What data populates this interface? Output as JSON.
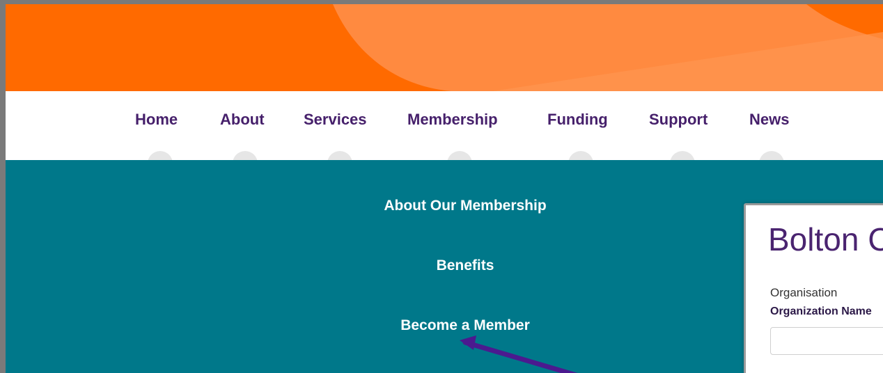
{
  "colors": {
    "hero_orange": "#ff6a00",
    "hero_shape": "#ff8a40",
    "nav_text": "#46206b",
    "dropdown_teal": "#00788a",
    "annotation_arrow": "#4b1a8f"
  },
  "nav": {
    "items": [
      {
        "label": "Home"
      },
      {
        "label": "About"
      },
      {
        "label": "Services"
      },
      {
        "label": "Membership"
      },
      {
        "label": "Funding"
      },
      {
        "label": "Support"
      },
      {
        "label": "News"
      }
    ]
  },
  "dropdown": {
    "items": [
      {
        "label": "About Our Membership"
      },
      {
        "label": "Benefits"
      },
      {
        "label": "Become a Member"
      }
    ]
  },
  "form": {
    "title": "Bolton C",
    "section_label": "Organisation",
    "field_label": "Organization Name",
    "field_value": ""
  }
}
